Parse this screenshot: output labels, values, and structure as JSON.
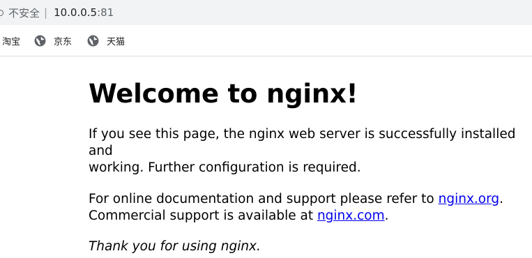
{
  "browser": {
    "security_label": "不安全",
    "separator": "|",
    "url_host": "10.0.0.5",
    "url_port": ":81"
  },
  "bookmarks": [
    {
      "label": "淘宝",
      "icon": "globe-icon"
    },
    {
      "label": "京东",
      "icon": "globe-icon"
    },
    {
      "label": "天猫",
      "icon": "globe-icon"
    }
  ],
  "page": {
    "heading": "Welcome to nginx!",
    "para1_line1": "If you see this page, the nginx web server is successfully installed and",
    "para1_line2": "working. Further configuration is required.",
    "para2_text1": "For online documentation and support please refer to ",
    "para2_link1": "nginx.org",
    "para2_text2": ".",
    "para2_text3": "Commercial support is available at ",
    "para2_link2": "nginx.com",
    "para2_text4": ".",
    "thanks": "Thank you for using nginx."
  },
  "colors": {
    "link": "#0000ee",
    "toolbar_bg": "#f1f3f4"
  }
}
